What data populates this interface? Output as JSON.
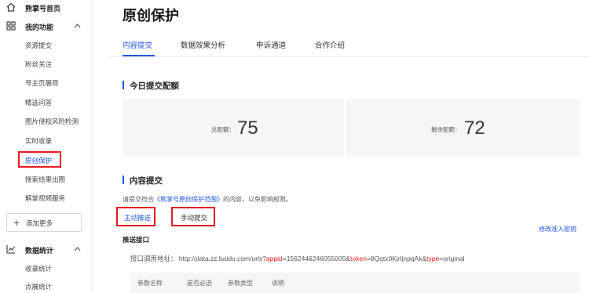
{
  "sidebar": {
    "home_label": "熊掌号首页",
    "my_functions_label": "我的功能",
    "items": [
      {
        "label": "资源提交"
      },
      {
        "label": "粉丝关注"
      },
      {
        "label": "号主页展现"
      },
      {
        "label": "精选问答"
      },
      {
        "label": "图片侵权风险检测"
      },
      {
        "label": "实时收录"
      },
      {
        "label": "原创保护",
        "active": true
      },
      {
        "label": "搜索结果出图"
      },
      {
        "label": "解掌视频服务"
      }
    ],
    "add_more_label": "添加更多",
    "data_stats_label": "数据统计",
    "stats_items": [
      {
        "label": "收录统计"
      },
      {
        "label": "点展统计"
      }
    ]
  },
  "main": {
    "title": "原创保护",
    "tabs": [
      {
        "label": "内容提交",
        "active": true
      },
      {
        "label": "数据效果分析"
      },
      {
        "label": "申诉通道"
      },
      {
        "label": "合作介绍"
      }
    ],
    "today_quota": {
      "title": "今日提交配额",
      "total_label": "总配额：",
      "total_value": "75",
      "remaining_label": "剩余配额：",
      "remaining_value": "72"
    },
    "content_submit": {
      "title": "内容提交",
      "desc_prefix": "请提交符合",
      "desc_link": "《熊掌号原创保护范围》",
      "desc_suffix": "的内容，以免影响权限。",
      "sub_tabs": [
        {
          "label": "主动推送",
          "active": true
        },
        {
          "label": "手动提交"
        }
      ],
      "modify_key_label": "修改准入密钥",
      "push_api_label": "推送接口",
      "endpoint_label": "接口调用地址：",
      "endpoint_url_base": "http://data.zz.baidu.com/urls?",
      "endpoint_param1_key": "appid",
      "endpoint_param1_val": "=1562446246055005&",
      "endpoint_param2_key": "token",
      "endpoint_param2_val": "=8Qqtx0KjrljnpqAk&",
      "endpoint_param3_key": "type",
      "endpoint_param3_val": "=original",
      "table_headers": [
        "参数名称",
        "是否必选",
        "参数类型",
        "说明"
      ]
    }
  },
  "colors": {
    "accent": "#1f55e8",
    "highlight_red": "#e8171c",
    "card_bg": "#f5f6f8"
  }
}
